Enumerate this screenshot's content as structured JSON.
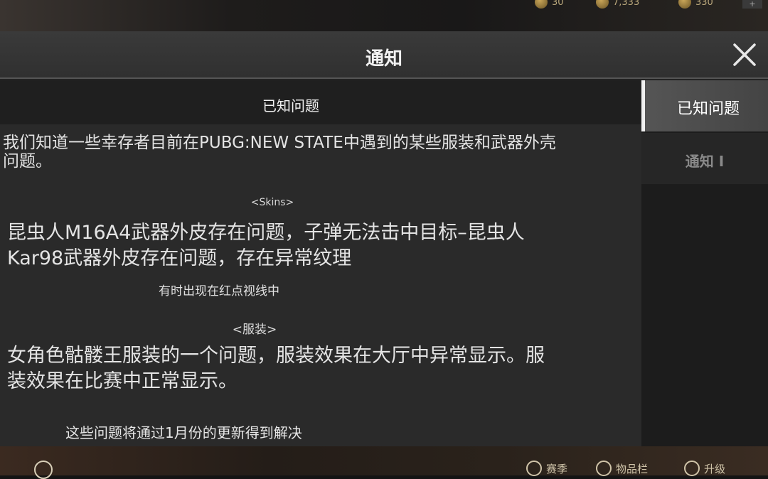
{
  "background": {
    "top_resources": [
      {
        "icon": "coin-icon",
        "value": "30"
      },
      {
        "icon": "coin-icon",
        "value": "7,333"
      },
      {
        "icon": "coin-icon",
        "value": "330"
      }
    ],
    "top_plus": "+",
    "bottom_items": [
      {
        "icon": "season-icon",
        "label": "赛季"
      },
      {
        "icon": "inventory-icon",
        "label": "物品栏"
      },
      {
        "icon": "upgrade-icon",
        "label": "升级"
      }
    ]
  },
  "modal": {
    "title": "通知",
    "close_icon": "close-icon",
    "content": {
      "header": "已知问题",
      "intro": "我们知道一些幸存者目前在PUBG:NEW STATE中遇到的某些服装和武器外壳问题。",
      "skins_heading": "<Skins>",
      "skins_body": "昆虫人M16A4武器外皮存在问题，子弹无法击中目标–昆虫人Kar98武器外皮存在问题，存在异常纹理",
      "skins_note": "有时出现在红点视线中",
      "outfit_heading": "<服装>",
      "outfit_body": "女角色骷髅王服装的一个问题，服装效果在大厅中异常显示。服装效果在比赛中正常显示。",
      "footer": "这些问题将通过1月份的更新得到解决"
    },
    "tabs": [
      {
        "label": "已知问题",
        "active": true
      },
      {
        "label": "通知 I",
        "active": false
      }
    ]
  },
  "colors": {
    "modal_bg": "#232323",
    "header_bg": "#333333",
    "active_tab_accent": "#f0f0f0"
  }
}
